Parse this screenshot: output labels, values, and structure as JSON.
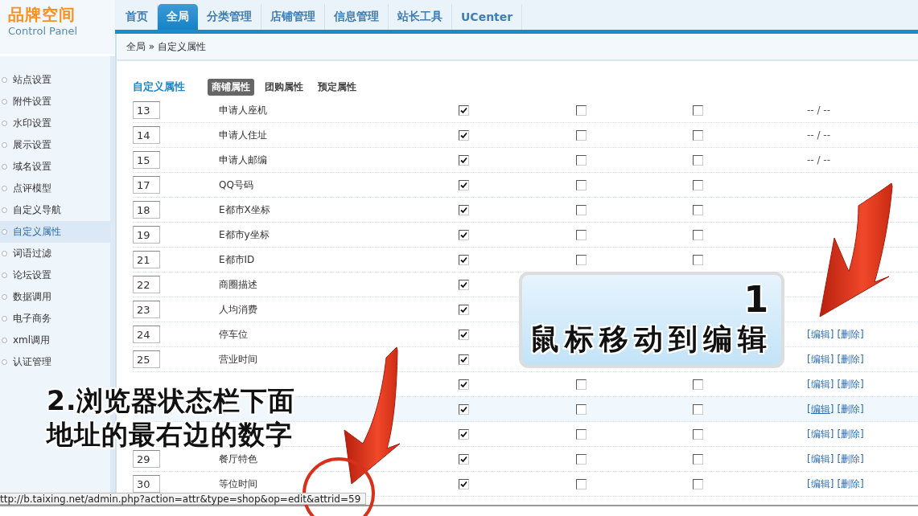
{
  "logo": {
    "title": "品牌空间",
    "subtitle": "Control Panel"
  },
  "nav_tabs": [
    {
      "label": "首页",
      "selected": false
    },
    {
      "label": "全局",
      "selected": true
    },
    {
      "label": "分类管理",
      "selected": false
    },
    {
      "label": "店铺管理",
      "selected": false
    },
    {
      "label": "信息管理",
      "selected": false
    },
    {
      "label": "站长工具",
      "selected": false
    },
    {
      "label": "UCenter",
      "selected": false
    }
  ],
  "breadcrumb": "全局 » 自定义属性",
  "sidebar": {
    "items": [
      {
        "label": "站点设置",
        "selected": false
      },
      {
        "label": "附件设置",
        "selected": false
      },
      {
        "label": "水印设置",
        "selected": false
      },
      {
        "label": "展示设置",
        "selected": false
      },
      {
        "label": "域名设置",
        "selected": false
      },
      {
        "label": "点评模型",
        "selected": false
      },
      {
        "label": "自定义导航",
        "selected": false
      },
      {
        "label": "自定义属性",
        "selected": true
      },
      {
        "label": "词语过滤",
        "selected": false
      },
      {
        "label": "论坛设置",
        "selected": false
      },
      {
        "label": "数据调用",
        "selected": false
      },
      {
        "label": "电子商务",
        "selected": false
      },
      {
        "label": "xml调用",
        "selected": false
      },
      {
        "label": "认证管理",
        "selected": false
      }
    ]
  },
  "section": {
    "title": "自定义属性",
    "tabs": [
      {
        "label": "商铺属性",
        "selected": true
      },
      {
        "label": "团购属性",
        "selected": false
      },
      {
        "label": "预定属性",
        "selected": false
      }
    ]
  },
  "rows": [
    {
      "order": "13",
      "name": "申请人座机",
      "checks": [
        true,
        false,
        false
      ],
      "actions": {
        "kind": "dash",
        "text": "-- / --"
      },
      "hovered": false
    },
    {
      "order": "14",
      "name": "申请人住址",
      "checks": [
        true,
        false,
        false
      ],
      "actions": {
        "kind": "dash",
        "text": "-- / --"
      },
      "hovered": false
    },
    {
      "order": "15",
      "name": "申请人邮编",
      "checks": [
        true,
        false,
        false
      ],
      "actions": {
        "kind": "dash",
        "text": "-- / --"
      },
      "hovered": false
    },
    {
      "order": "17",
      "name": "QQ号码",
      "checks": [
        true,
        false,
        false
      ],
      "hovered": false
    },
    {
      "order": "18",
      "name": "E都市X坐标",
      "checks": [
        true,
        false,
        false
      ],
      "hovered": false
    },
    {
      "order": "19",
      "name": "E都市y坐标",
      "checks": [
        true,
        false,
        false
      ],
      "hovered": false
    },
    {
      "order": "21",
      "name": "E都市ID",
      "checks": [
        true,
        false,
        false
      ],
      "hovered": false
    },
    {
      "order": "22",
      "name": "商圈描述",
      "checks": [
        true
      ],
      "hovered": false
    },
    {
      "order": "23",
      "name": "人均消费",
      "checks": [
        true
      ],
      "hovered": false
    },
    {
      "order": "24",
      "name": "停车位",
      "checks": [
        true
      ],
      "actions": {
        "kind": "links",
        "edit": "[编辑]",
        "delete": "[删除]"
      },
      "hovered": false
    },
    {
      "order": "25",
      "name": "营业时间",
      "checks": [
        true
      ],
      "actions": {
        "kind": "links",
        "edit": "[编辑]",
        "delete": "[删除]"
      },
      "hovered": false
    },
    {
      "checks": [
        true,
        false,
        false
      ],
      "actions": {
        "kind": "links",
        "edit": "[编辑]",
        "delete": "[删除]"
      },
      "hovered": false
    },
    {
      "checks": [
        true,
        false,
        false
      ],
      "actions": {
        "kind": "links",
        "edit": "[编辑]",
        "delete": "[删除]"
      },
      "hovered": true
    },
    {
      "checks": [
        true,
        false,
        false
      ],
      "actions": {
        "kind": "links",
        "edit": "[编辑]",
        "delete": "[删除]"
      },
      "hovered": false
    },
    {
      "order": "29",
      "name": "餐厅特色",
      "checks": [
        true,
        false,
        false
      ],
      "actions": {
        "kind": "links",
        "edit": "[编辑]",
        "delete": "[删除]"
      },
      "hovered": false
    },
    {
      "order": "30",
      "name": "等位时间",
      "checks": [
        true,
        false,
        false
      ],
      "actions": {
        "kind": "links",
        "edit": "[编辑]",
        "delete": "[删除]"
      },
      "hovered": false
    }
  ],
  "annotations": [
    {
      "kind": "callout",
      "number": "1",
      "text": "鼠标移动到编辑"
    },
    {
      "kind": "caption",
      "lines": [
        "2.浏览器状态栏下面",
        "地址的最右边的数字"
      ]
    }
  ],
  "status_bar": {
    "url": "ttp://b.taixing.net/admin.php?action=attr&type=shop&op=edit&attrid=59"
  }
}
